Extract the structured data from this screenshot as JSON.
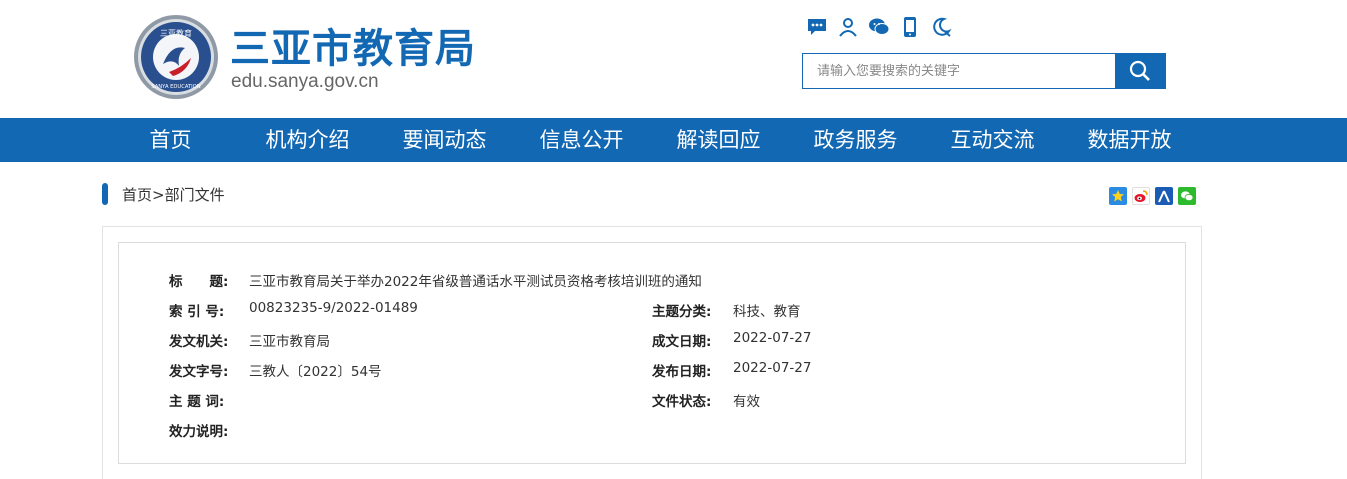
{
  "header": {
    "logo_text_top": "三亚教育",
    "logo_text_bottom": "SANYA EDUCATION",
    "title": "三亚市教育局",
    "domain": "edu.sanya.gov.cn",
    "search_placeholder": "请输入您要搜索的关键字"
  },
  "top_icons": [
    "chat-icon",
    "user-icon",
    "wechat-icon",
    "mobile-icon",
    "elder-mode-icon"
  ],
  "nav": {
    "items": [
      "首页",
      "机构介绍",
      "要闻动态",
      "信息公开",
      "解读回应",
      "政务服务",
      "互动交流",
      "数据开放"
    ]
  },
  "breadcrumb": {
    "home": "首页",
    "separator": ">",
    "current": "部门文件"
  },
  "share_icons": [
    "qzone-icon",
    "weibo-icon",
    "renren-icon",
    "wechat-share-icon"
  ],
  "info": {
    "title_label": "标　　题:",
    "title_value": "三亚市教育局关于举办2022年省级普通话水平测试员资格考核培训班的通知",
    "index_label": "索 引 号:",
    "index_value": "00823235-9/2022-01489",
    "category_label": "主题分类:",
    "category_value": "科技、教育",
    "issuer_label": "发文机关:",
    "issuer_value": "三亚市教育局",
    "written_date_label": "成文日期:",
    "written_date_value": "2022-07-27",
    "doc_no_label": "发文字号:",
    "doc_no_value": "三教人〔2022〕54号",
    "publish_date_label": "发布日期:",
    "publish_date_value": "2022-07-27",
    "keywords_label": "主 题 词:",
    "keywords_value": "",
    "status_label": "文件状态:",
    "status_value": "有效",
    "effect_label": "效力说明:",
    "effect_value": ""
  },
  "colors": {
    "brand_blue": "#1268b3"
  }
}
